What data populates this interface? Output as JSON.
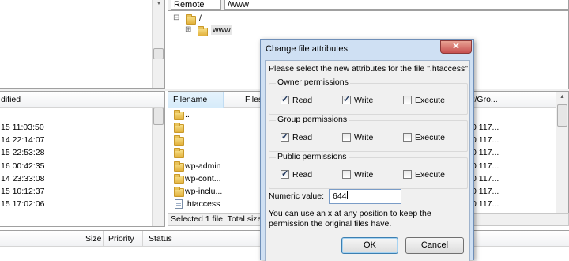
{
  "remote": {
    "label": "Remote site:",
    "path": "/www",
    "tree": [
      {
        "name": "/",
        "toggle": "⊟"
      },
      {
        "name": "www",
        "toggle": "⊞"
      }
    ]
  },
  "local_list": {
    "header_modified": "dified",
    "rows": [
      "15 11:03:50",
      "14 22:14:07",
      "15 22:53:28",
      "16 00:42:35",
      "14 23:33:08",
      "15 10:12:37",
      "15 17:02:06"
    ]
  },
  "remote_list": {
    "header_filename": "Filename",
    "header_filesize": "Files",
    "header_owner": "r/Gro...",
    "rows": [
      {
        "name": "..",
        "icon": "folder-icon"
      },
      {
        "name": "",
        "icon": "folder-icon"
      },
      {
        "name": "",
        "icon": "folder-icon"
      },
      {
        "name": "",
        "icon": "folder-icon"
      },
      {
        "name": "wp-admin",
        "icon": "folder-icon"
      },
      {
        "name": "wp-cont...",
        "icon": "folder-icon"
      },
      {
        "name": "wp-inclu...",
        "icon": "folder-icon"
      },
      {
        "name": ".htaccess",
        "icon": "file-icon"
      }
    ],
    "owner_values": [
      "0 117...",
      "0 117...",
      "0 117...",
      "0 117...",
      "0 117...",
      "0 117...",
      "0 117..."
    ],
    "status": "Selected 1 file. Total size:"
  },
  "queue": {
    "col_size": "Size",
    "col_priority": "Priority",
    "col_status": "Status"
  },
  "dialog": {
    "title": "Change file attributes",
    "close_glyph": "✕",
    "instruction": "Please select the new attributes for the file \".htaccess\".",
    "groups": [
      {
        "title": "Owner permissions",
        "read": true,
        "write": true,
        "execute": false
      },
      {
        "title": "Group permissions",
        "read": true,
        "write": false,
        "execute": false
      },
      {
        "title": "Public permissions",
        "read": true,
        "write": false,
        "execute": false
      }
    ],
    "labels": {
      "read": "Read",
      "write": "Write",
      "execute": "Execute"
    },
    "numeric_label": "Numeric value:",
    "numeric_value": "644",
    "hint": "You can use an x at any position to keep the permission the original files have.",
    "ok_label": "OK",
    "cancel_label": "Cancel",
    "check_glyph": "✓"
  },
  "colors": {
    "dialog_frame": "#cfe0f3",
    "dialog_body": "#f0f0f0",
    "selection": "#3399ff"
  }
}
